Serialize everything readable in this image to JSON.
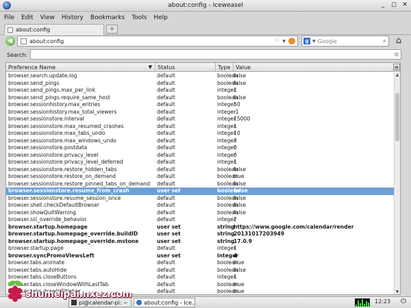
{
  "window": {
    "title": "about:config - Iceweasel",
    "controls": [
      "_",
      "◻",
      "✕"
    ]
  },
  "menu": [
    "File",
    "Edit",
    "View",
    "History",
    "Bookmarks",
    "Tools",
    "Help"
  ],
  "tab": {
    "label": "about:config",
    "new_tab_icon": "+"
  },
  "nav": {
    "url": "about:config",
    "search_placeholder": "Google",
    "back_icon": "◀",
    "home_icon": "⌂"
  },
  "filter": {
    "label": "Search:",
    "value": ""
  },
  "table": {
    "columns": [
      "Preference Name",
      "Status",
      "Type",
      "Value"
    ],
    "selected_index": 16,
    "rows": [
      {
        "name": "browser.search.update.log",
        "status": "default",
        "type": "boolean",
        "value": "false",
        "bold": false
      },
      {
        "name": "browser.send_pings",
        "status": "default",
        "type": "boolean",
        "value": "false",
        "bold": false
      },
      {
        "name": "browser.send_pings.max_per_link",
        "status": "default",
        "type": "integer",
        "value": "1",
        "bold": false
      },
      {
        "name": "browser.send_pings.require_same_host",
        "status": "default",
        "type": "boolean",
        "value": "false",
        "bold": false
      },
      {
        "name": "browser.sessionhistory.max_entries",
        "status": "default",
        "type": "integer",
        "value": "50",
        "bold": false
      },
      {
        "name": "browser.sessionhistory.max_total_viewers",
        "status": "default",
        "type": "integer",
        "value": "-1",
        "bold": false
      },
      {
        "name": "browser.sessionstore.interval",
        "status": "default",
        "type": "integer",
        "value": "15000",
        "bold": false
      },
      {
        "name": "browser.sessionstore.max_resumed_crashes",
        "status": "default",
        "type": "integer",
        "value": "1",
        "bold": false
      },
      {
        "name": "browser.sessionstore.max_tabs_undo",
        "status": "default",
        "type": "integer",
        "value": "10",
        "bold": false
      },
      {
        "name": "browser.sessionstore.max_windows_undo",
        "status": "default",
        "type": "integer",
        "value": "3",
        "bold": false
      },
      {
        "name": "browser.sessionstore.postdata",
        "status": "default",
        "type": "integer",
        "value": "0",
        "bold": false
      },
      {
        "name": "browser.sessionstore.privacy_level",
        "status": "default",
        "type": "integer",
        "value": "0",
        "bold": false
      },
      {
        "name": "browser.sessionstore.privacy_level_deferred",
        "status": "default",
        "type": "integer",
        "value": "1",
        "bold": false
      },
      {
        "name": "browser.sessionstore.restore_hidden_tabs",
        "status": "default",
        "type": "boolean",
        "value": "false",
        "bold": false
      },
      {
        "name": "browser.sessionstore.restore_on_demand",
        "status": "default",
        "type": "boolean",
        "value": "true",
        "bold": false
      },
      {
        "name": "browser.sessionstore.restore_pinned_tabs_on_demand",
        "status": "default",
        "type": "boolean",
        "value": "false",
        "bold": false
      },
      {
        "name": "browser.sessionstore.resume_from_crash",
        "status": "user set",
        "type": "boolean",
        "value": "false",
        "bold": true
      },
      {
        "name": "browser.sessionstore.resume_session_once",
        "status": "default",
        "type": "boolean",
        "value": "false",
        "bold": false
      },
      {
        "name": "browser.shell.checkDefaultBrowser",
        "status": "default",
        "type": "boolean",
        "value": "false",
        "bold": false
      },
      {
        "name": "browser.showQuitWarning",
        "status": "default",
        "type": "boolean",
        "value": "false",
        "bold": false
      },
      {
        "name": "browser.ssl_override_behavior",
        "status": "default",
        "type": "integer",
        "value": "2",
        "bold": false
      },
      {
        "name": "browser.startup.homepage",
        "status": "user set",
        "type": "string",
        "value": "https://www.google.com/calendar/render",
        "bold": true
      },
      {
        "name": "browser.startup.homepage_override.buildID",
        "status": "user set",
        "type": "string",
        "value": "20131017203949",
        "bold": true
      },
      {
        "name": "browser.startup.homepage_override.mstone",
        "status": "user set",
        "type": "string",
        "value": "17.0.9",
        "bold": true
      },
      {
        "name": "browser.startup.page",
        "status": "default",
        "type": "integer",
        "value": "1",
        "bold": false
      },
      {
        "name": "browser.syncPromoViewsLeft",
        "status": "user set",
        "type": "integer",
        "value": "4",
        "bold": true
      },
      {
        "name": "browser.tabs.animate",
        "status": "default",
        "type": "boolean",
        "value": "true",
        "bold": false
      },
      {
        "name": "browser.tabs.autoHide",
        "status": "default",
        "type": "boolean",
        "value": "false",
        "bold": false
      },
      {
        "name": "browser.tabs.closeButtons",
        "status": "default",
        "type": "integer",
        "value": "1",
        "bold": false
      },
      {
        "name": "browser.tabs.closeWindowWithLastTab",
        "status": "default",
        "type": "boolean",
        "value": "true",
        "bold": false
      },
      {
        "name": "browser.tabs.drawInTitlebar",
        "status": "default",
        "type": "boolean",
        "value": "true",
        "bold": false
      }
    ]
  },
  "taskbar": {
    "tasks": [
      "pi@calendar-pi: ~",
      "about:config - Ice..."
    ],
    "clock": "12:23",
    "power_icon": "⏻"
  },
  "watermark": "shumeipai.nxez.com",
  "colors": {
    "selection": "#6e9fd3",
    "raspberry": "#c51a4a",
    "leaf": "#6cc04a"
  }
}
